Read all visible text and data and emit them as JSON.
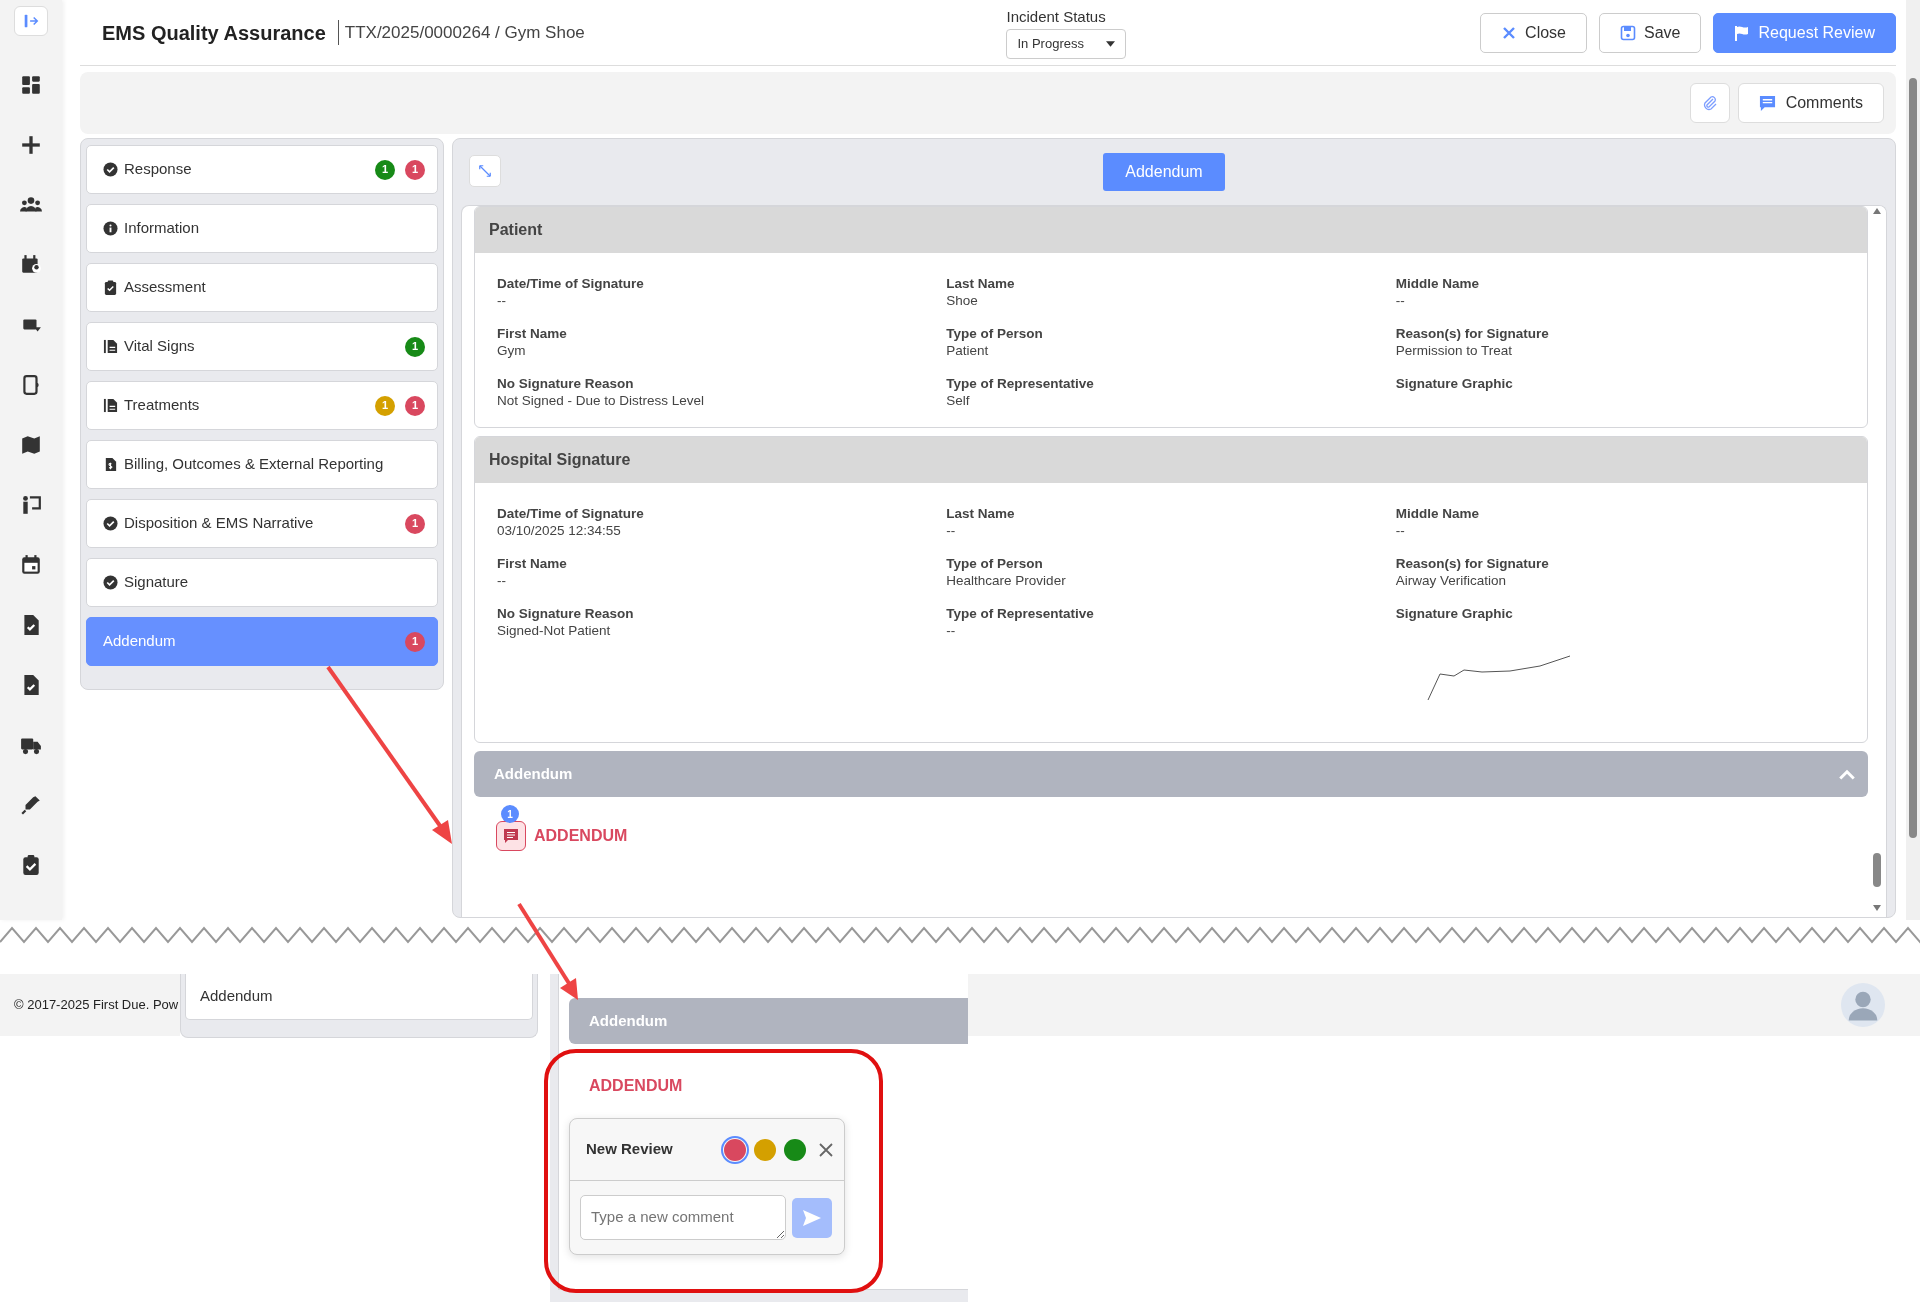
{
  "header": {
    "title": "EMS Quality Assurance",
    "subtitle": "TTX/2025/0000264 / Gym Shoe",
    "status_label": "Incident Status",
    "status_value": "In Progress",
    "buttons": [
      {
        "label": "Close",
        "kind": "close"
      },
      {
        "label": "Save",
        "kind": "save"
      },
      {
        "label": "Request Review",
        "kind": "primary"
      }
    ]
  },
  "toolbar": {
    "comments_label": "Comments"
  },
  "nav": [
    {
      "label": "Response",
      "kind": "check",
      "selected": false,
      "badges": [
        {
          "count": "1",
          "color": "#178a17"
        },
        {
          "count": "1",
          "color": "#d9485f"
        }
      ]
    },
    {
      "label": "Information",
      "kind": "info",
      "selected": false
    },
    {
      "label": "Assessment",
      "kind": "clipboard",
      "selected": false
    },
    {
      "label": "Vital Signs",
      "kind": "file",
      "selected": false,
      "badges": [
        {
          "count": "1",
          "color": "#178a17"
        }
      ]
    },
    {
      "label": "Treatments",
      "kind": "file",
      "selected": false,
      "badges": [
        {
          "count": "1",
          "color": "#d4a000"
        },
        {
          "count": "1",
          "color": "#d9485f"
        }
      ]
    },
    {
      "label": "Billing, Outcomes & External Reporting",
      "kind": "invoice",
      "selected": false
    },
    {
      "label": "Disposition & EMS Narrative",
      "kind": "check",
      "selected": false,
      "badges": [
        {
          "count": "1",
          "color": "#d9485f"
        }
      ]
    },
    {
      "label": "Signature",
      "kind": "check",
      "selected": false
    },
    {
      "label": "Addendum",
      "kind": "plain",
      "selected": true,
      "badges": [
        {
          "count": "1",
          "color": "#d9485f"
        }
      ]
    }
  ],
  "panel": {
    "title_button": "Addendum",
    "sections": [
      {
        "title": "Patient",
        "fields": [
          {
            "label": "Date/Time of Signature",
            "value": "--"
          },
          {
            "label": "Last Name",
            "value": "Shoe"
          },
          {
            "label": "Middle Name",
            "value": "--"
          },
          {
            "label": "First Name",
            "value": "Gym"
          },
          {
            "label": "Type of Person",
            "value": "Patient"
          },
          {
            "label": "Reason(s) for Signature",
            "value": "Permission to Treat"
          },
          {
            "label": "No Signature Reason",
            "value": "Not Signed - Due to Distress Level"
          },
          {
            "label": "Type of Representative",
            "value": "Self"
          },
          {
            "label": "Signature Graphic",
            "kind": "signature",
            "signed": false
          }
        ]
      },
      {
        "title": "Hospital Signature",
        "fields": [
          {
            "label": "Date/Time of Signature",
            "value": "03/10/2025 12:34:55"
          },
          {
            "label": "Last Name",
            "value": "--"
          },
          {
            "label": "Middle Name",
            "value": "--"
          },
          {
            "label": "First Name",
            "value": "--"
          },
          {
            "label": "Type of Person",
            "value": "Healthcare Provider"
          },
          {
            "label": "Reason(s) for Signature",
            "value": "Airway Verification"
          },
          {
            "label": "No Signature Reason",
            "value": "Signed-Not Patient"
          },
          {
            "label": "Type of Representative",
            "value": "--"
          },
          {
            "label": "Signature Graphic",
            "kind": "signature",
            "signed": true
          }
        ]
      }
    ],
    "addendum": {
      "title": "Addendum",
      "expanded": true,
      "count": "1",
      "label": "ADDENDUM"
    }
  },
  "zoomed": {
    "footer": "© 2017-2025 First Due. Pow",
    "nav_item": "Addendum",
    "section_title": "Addendum",
    "item_label": "ADDENDUM",
    "review": {
      "title": "New Review",
      "placeholder": "Type a new comment",
      "colors": [
        {
          "color": "#d9485f",
          "selected": true
        },
        {
          "color": "#d4a000",
          "selected": false
        },
        {
          "color": "#178a17",
          "selected": false
        }
      ]
    }
  }
}
